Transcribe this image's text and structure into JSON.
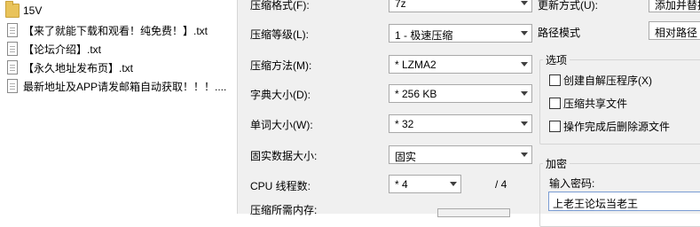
{
  "file_list": [
    {
      "name": "15V",
      "icon": "folder-icon"
    },
    {
      "name": "【来了就能下载和观看！纯免费！】.txt",
      "icon": "text-file-icon"
    },
    {
      "name": "【论坛介绍】.txt",
      "icon": "text-file-icon"
    },
    {
      "name": "【永久地址发布页】.txt",
      "icon": "text-file-icon"
    },
    {
      "name": "最新地址及APP请发邮箱自动获取！！！....",
      "icon": "text-file-icon"
    }
  ],
  "left": {
    "format_label": "压缩格式(F):",
    "format_value": "7z",
    "level_label": "压缩等级(L):",
    "level_value": "1 - 极速压缩",
    "method_label": "压缩方法(M):",
    "method_value": "* LZMA2",
    "dict_label": "字典大小(D):",
    "dict_value": "* 256 KB",
    "word_label": "单词大小(W):",
    "word_value": "* 32",
    "solid_label": "固实数据大小:",
    "solid_value": "固实",
    "threads_label": "CPU 线程数:",
    "threads_value": "* 4",
    "threads_total": "/ 4",
    "memory_label": "压缩所需内存:"
  },
  "right": {
    "update_label": "更新方式(U):",
    "update_value": "添加并替换",
    "path_label": "路径模式",
    "path_value": "相对路径",
    "options_title": "选项",
    "opt_sfx": "创建自解压程序(X)",
    "opt_shared": "压缩共享文件",
    "opt_delete": "操作完成后删除源文件",
    "encryption_title": "加密",
    "password_label": "输入密码:",
    "password_value": "上老王论坛当老王"
  }
}
